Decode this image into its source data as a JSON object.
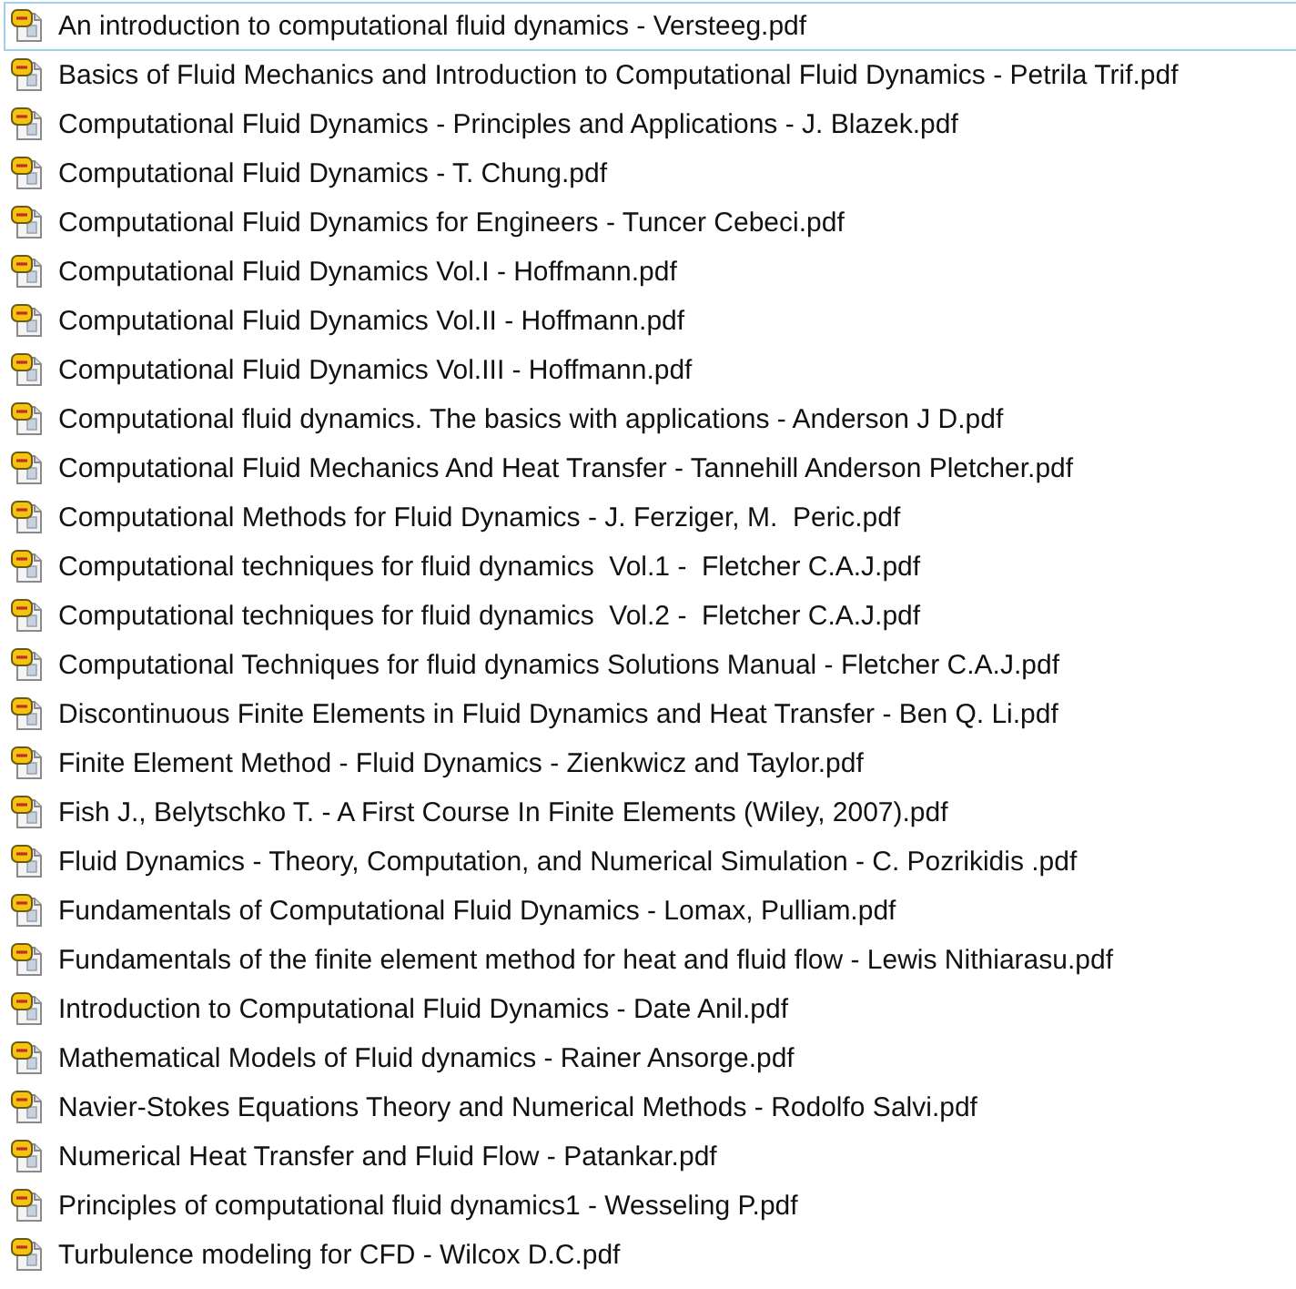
{
  "files": [
    {
      "name": "An introduction to computational fluid dynamics - Versteeg.pdf",
      "selected": true
    },
    {
      "name": "Basics of Fluid Mechanics and Introduction to Computational Fluid Dynamics - Petrila Trif.pdf",
      "selected": false
    },
    {
      "name": "Computational Fluid Dynamics - Principles and Applications - J. Blazek.pdf",
      "selected": false
    },
    {
      "name": "Computational Fluid Dynamics - T. Chung.pdf",
      "selected": false
    },
    {
      "name": "Computational Fluid Dynamics for Engineers - Tuncer Cebeci.pdf",
      "selected": false
    },
    {
      "name": "Computational Fluid Dynamics Vol.I - Hoffmann.pdf",
      "selected": false
    },
    {
      "name": "Computational Fluid Dynamics Vol.II - Hoffmann.pdf",
      "selected": false
    },
    {
      "name": "Computational Fluid Dynamics Vol.III - Hoffmann.pdf",
      "selected": false
    },
    {
      "name": "Computational fluid dynamics. The basics with applications - Anderson J D.pdf",
      "selected": false
    },
    {
      "name": "Computational Fluid Mechanics And Heat Transfer - Tannehill Anderson Pletcher.pdf",
      "selected": false
    },
    {
      "name": "Computational Methods for Fluid Dynamics - J. Ferziger, M.  Peric.pdf",
      "selected": false
    },
    {
      "name": "Computational techniques for fluid dynamics  Vol.1 -  Fletcher C.A.J.pdf",
      "selected": false
    },
    {
      "name": "Computational techniques for fluid dynamics  Vol.2 -  Fletcher C.A.J.pdf",
      "selected": false
    },
    {
      "name": "Computational Techniques for fluid dynamics Solutions Manual - Fletcher C.A.J.pdf",
      "selected": false
    },
    {
      "name": "Discontinuous Finite Elements in Fluid Dynamics and Heat Transfer - Ben Q. Li.pdf",
      "selected": false
    },
    {
      "name": "Finite Element Method - Fluid Dynamics - Zienkwicz and Taylor.pdf",
      "selected": false
    },
    {
      "name": "Fish J., Belytschko T. - A First Course In Finite Elements (Wiley, 2007).pdf",
      "selected": false
    },
    {
      "name": "Fluid Dynamics - Theory, Computation, and Numerical Simulation - C. Pozrikidis .pdf",
      "selected": false
    },
    {
      "name": "Fundamentals of Computational Fluid Dynamics - Lomax, Pulliam.pdf",
      "selected": false
    },
    {
      "name": "Fundamentals of the finite element method for heat and fluid flow - Lewis Nithiarasu.pdf",
      "selected": false
    },
    {
      "name": "Introduction to Computational Fluid Dynamics - Date Anil.pdf",
      "selected": false
    },
    {
      "name": "Mathematical Models of Fluid dynamics - Rainer Ansorge.pdf",
      "selected": false
    },
    {
      "name": "Navier-Stokes Equations Theory and Numerical Methods - Rodolfo Salvi.pdf",
      "selected": false
    },
    {
      "name": "Numerical Heat Transfer and Fluid Flow - Patankar.pdf",
      "selected": false
    },
    {
      "name": "Principles of computational fluid dynamics1 - Wesseling P.pdf",
      "selected": false
    },
    {
      "name": "Turbulence modeling for CFD - Wilcox D.C.pdf",
      "selected": false
    }
  ]
}
